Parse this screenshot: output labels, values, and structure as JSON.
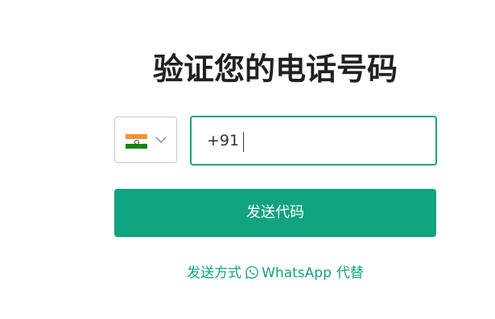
{
  "heading": {
    "title": "验证您的电话号码"
  },
  "phone": {
    "country_flag": "india-flag",
    "country_chevron": "chevron-down-icon",
    "value": "+91"
  },
  "actions": {
    "send_code_label": "发送代码",
    "alt_prefix": "发送方式",
    "alt_service": "WhatsApp",
    "alt_suffix": "代替",
    "alt_icon": "whatsapp-icon"
  },
  "colors": {
    "accent": "#10a37f",
    "title": "#202123",
    "border": "#c2c8d0"
  }
}
